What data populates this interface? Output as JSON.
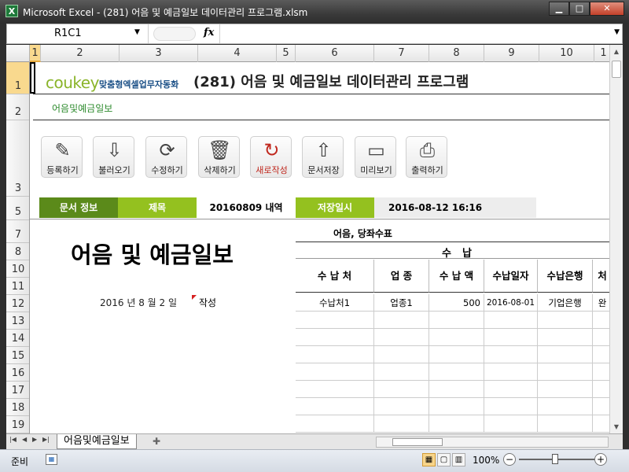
{
  "window": {
    "title": "Microsoft Excel - (281) 어음 및 예금일보 데이터관리 프로그램.xlsm",
    "app_icon": "X",
    "min": "▁",
    "max": "□",
    "close": "✕"
  },
  "formula_bar": {
    "name_box": "R1C1",
    "fx": "fx",
    "value": ""
  },
  "columns": [
    "1",
    "2",
    "3",
    "4",
    "5",
    "6",
    "7",
    "8",
    "9",
    "10",
    "1"
  ],
  "rows": [
    "1",
    "2",
    "3",
    "5",
    "7",
    "8",
    "10",
    "11",
    "12",
    "13",
    "14",
    "15",
    "16",
    "17",
    "18",
    "19"
  ],
  "sheet": {
    "logo": "coukey",
    "logo_sub": "맞춤형엑셀업무자동화",
    "app_title": "(281) 어음 및 예금일보 데이터관리 프로그램",
    "green_link": "어음및예금일보",
    "toolbar": [
      {
        "label": "등록하기",
        "icon": "pencil-icon",
        "glyph": "✎"
      },
      {
        "label": "불러오기",
        "icon": "load-icon",
        "glyph": "⇩"
      },
      {
        "label": "수정하기",
        "icon": "refresh-icon",
        "glyph": "⟳"
      },
      {
        "label": "삭제하기",
        "icon": "trash-icon",
        "glyph": "🗑"
      },
      {
        "label": "새로작성",
        "icon": "new-icon",
        "glyph": "↻"
      },
      {
        "label": "문서저장",
        "icon": "folder-save-icon",
        "glyph": "⇧"
      },
      {
        "label": "미리보기",
        "icon": "monitor-icon",
        "glyph": "▭"
      },
      {
        "label": "출력하기",
        "icon": "printer-icon",
        "glyph": "⎙"
      }
    ],
    "info": {
      "doc_info": "문서 정보",
      "title_label": "제목",
      "title_value": "20160809 내역",
      "saved_label": "저장일시",
      "saved_value": "2016-08-12 16:16"
    },
    "doc_title": "어음 및 예금일보",
    "date_line": "2016 년 8 월 2 일",
    "date_suffix": "작성",
    "section_label": "어음, 당좌수표",
    "table": {
      "group_header": "수납",
      "headers": [
        "수 납 처",
        "업 종",
        "수 납 액",
        "수납일자",
        "수납은행",
        "처"
      ],
      "rows": [
        [
          "수납처1",
          "업종1",
          "500",
          "2016-08-01",
          "기업은행",
          "완"
        ]
      ]
    }
  },
  "sheet_tab": "어음및예금일보",
  "status": {
    "ready": "준비",
    "zoom": "100%"
  }
}
